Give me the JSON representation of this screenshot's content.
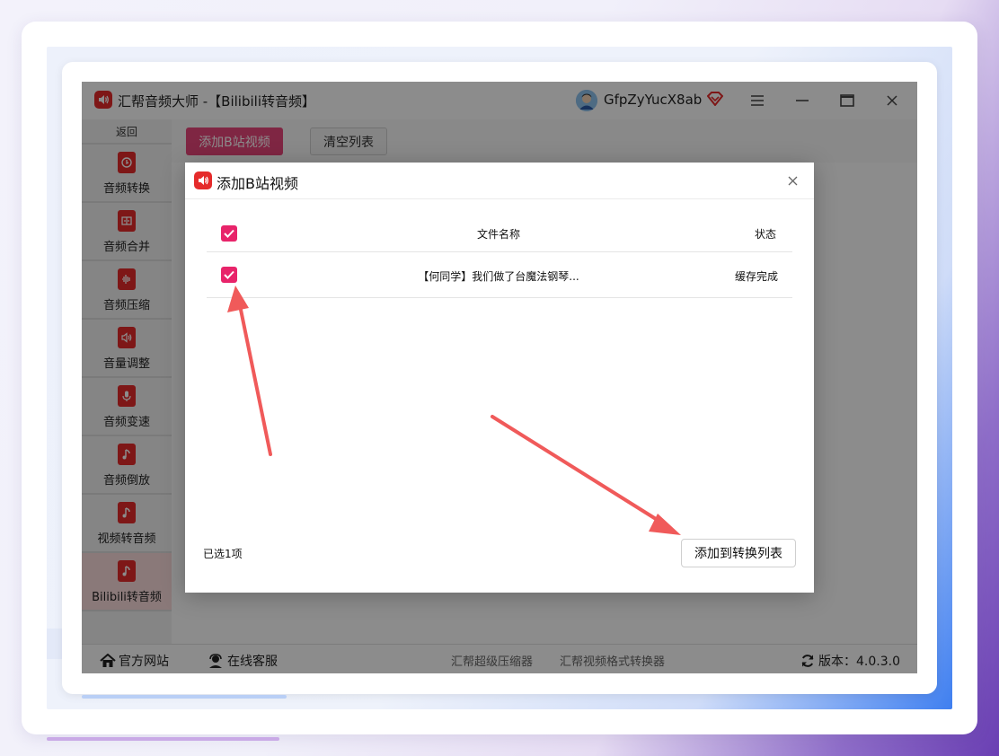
{
  "app": {
    "title": "汇帮音频大师  -【Bilibili转音频】",
    "username": "GfpZyYucX8ab"
  },
  "sidebar": {
    "back_label": "返回",
    "items": [
      {
        "label": "音频转换",
        "icon": "audio-convert-icon"
      },
      {
        "label": "音频合并",
        "icon": "audio-merge-icon"
      },
      {
        "label": "音频压缩",
        "icon": "audio-compress-icon"
      },
      {
        "label": "音量调整",
        "icon": "volume-icon"
      },
      {
        "label": "音频变速",
        "icon": "microphone-icon"
      },
      {
        "label": "音频倒放",
        "icon": "music-note-icon"
      },
      {
        "label": "视频转音频",
        "icon": "music-note-icon"
      },
      {
        "label": "Bilibili转音频",
        "icon": "music-note-icon"
      }
    ]
  },
  "toolbar": {
    "add_label": "添加B站视频",
    "clear_label": "清空列表"
  },
  "statusbar": {
    "website": "官方网站",
    "support": "在线客服",
    "link1": "汇帮超级压缩器",
    "link2": "汇帮视频格式转换器",
    "version": "版本：4.0.3.0"
  },
  "modal": {
    "title": "添加B站视频",
    "columns": {
      "name": "文件名称",
      "status": "状态"
    },
    "rows": [
      {
        "name": "【何同学】我们做了台魔法钢琴...",
        "status": "缓存完成"
      }
    ],
    "selected_count": "已选1项",
    "add_button": "添加到转换列表"
  },
  "colors": {
    "accent": "#e8246a",
    "brand_red": "#e52b2b",
    "annotation_arrow": "#f05a5a"
  }
}
